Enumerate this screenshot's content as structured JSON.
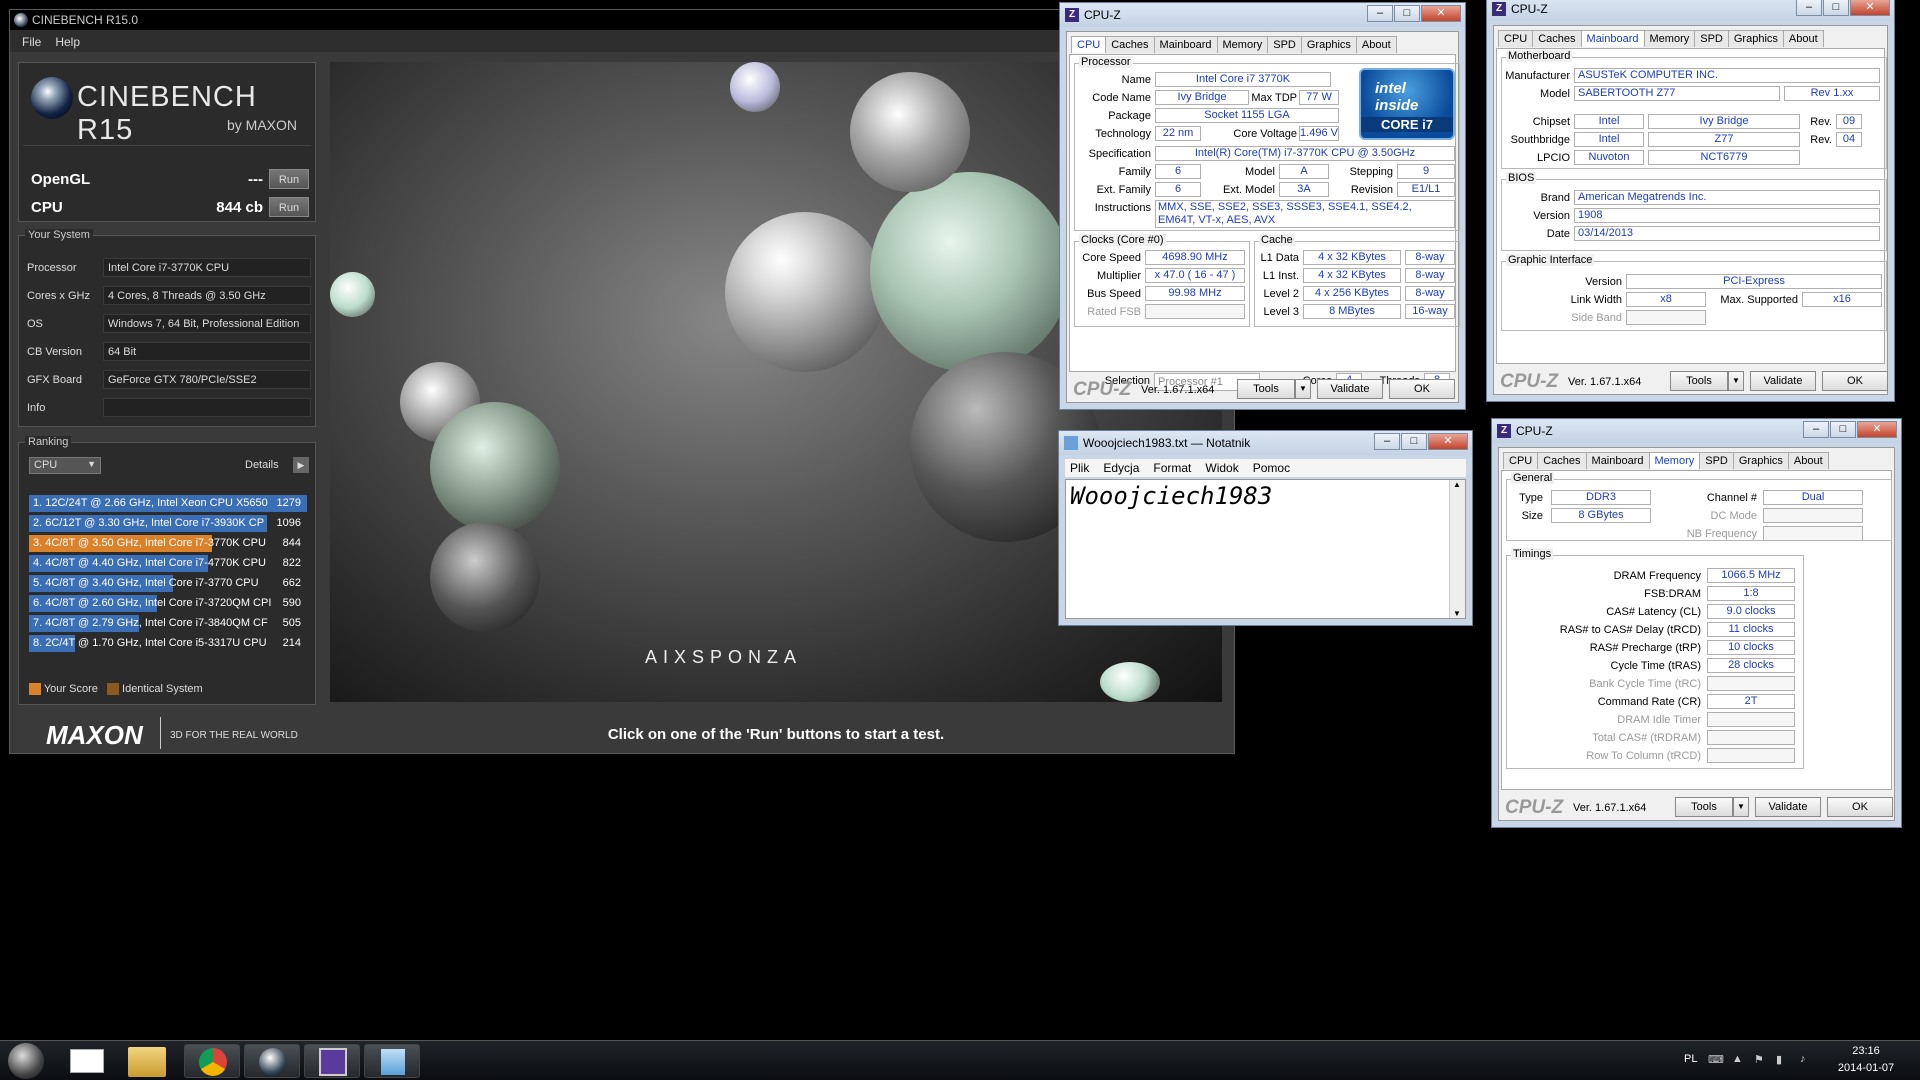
{
  "cinebench": {
    "title": "CINEBENCH R15.0",
    "menu": [
      "File",
      "Help"
    ],
    "logo_name": "CINEBENCH R15",
    "logo_by": "by MAXON",
    "opengl_label": "OpenGL",
    "opengl_value": "---",
    "cpu_label": "CPU",
    "cpu_value": "844 cb",
    "run_label": "Run",
    "your_system": "Your System",
    "system": [
      {
        "label": "Processor",
        "value": "Intel Core i7-3770K CPU"
      },
      {
        "label": "Cores x GHz",
        "value": "4 Cores, 8 Threads @ 3.50 GHz"
      },
      {
        "label": "OS",
        "value": "Windows 7, 64 Bit, Professional Edition"
      },
      {
        "label": "CB Version",
        "value": "64 Bit"
      },
      {
        "label": "GFX Board",
        "value": "GeForce GTX 780/PCIe/SSE2"
      },
      {
        "label": "Info",
        "value": ""
      }
    ],
    "ranking_title": "Ranking",
    "ranking_select": "CPU",
    "details_label": "Details",
    "ranking": [
      {
        "text": "1. 12C/24T @ 2.66 GHz, Intel Xeon CPU X5650",
        "score": "1279",
        "fill": 1.0,
        "color": "#3a6fb5"
      },
      {
        "text": "2. 6C/12T @ 3.30 GHz,  Intel Core i7-3930K CP",
        "score": "1096",
        "fill": 0.857,
        "color": "#3a6fb5"
      },
      {
        "text": "3. 4C/8T @ 3.50 GHz,  Intel Core i7-3770K CPU",
        "score": "844",
        "fill": 0.66,
        "color": "#d9822b"
      },
      {
        "text": "4. 4C/8T @ 4.40 GHz, Intel Core i7-4770K CPU",
        "score": "822",
        "fill": 0.643,
        "color": "#3a6fb5"
      },
      {
        "text": "5. 4C/8T @ 3.40 GHz,  Intel Core i7-3770 CPU",
        "score": "662",
        "fill": 0.518,
        "color": "#3a6fb5"
      },
      {
        "text": "6. 4C/8T @ 2.60 GHz, Intel Core i7-3720QM CPI",
        "score": "590",
        "fill": 0.461,
        "color": "#3a6fb5"
      },
      {
        "text": "7. 4C/8T @ 2.79 GHz,  Intel Core i7-3840QM CF",
        "score": "505",
        "fill": 0.395,
        "color": "#3a6fb5"
      },
      {
        "text": "8. 2C/4T @ 1.70 GHz,  Intel Core i5-3317U CPU",
        "score": "214",
        "fill": 0.167,
        "color": "#3a6fb5"
      }
    ],
    "legend_your": "Your Score",
    "legend_identical": "Identical System",
    "maxon": "MAXON",
    "tagline": "3D FOR THE REAL WORLD",
    "aixsponza": "AIXSPONZA",
    "status": "Click on one of the 'Run' buttons to start a test."
  },
  "cpuz1": {
    "title": "CPU-Z",
    "tabs": [
      "CPU",
      "Caches",
      "Mainboard",
      "Memory",
      "SPD",
      "Graphics",
      "About"
    ],
    "processor": "Processor",
    "name_l": "Name",
    "name": "Intel Core i7 3770K",
    "code_l": "Code Name",
    "code": "Ivy Bridge",
    "tdp_l": "Max TDP",
    "tdp": "77 W",
    "pkg_l": "Package",
    "pkg": "Socket 1155 LGA",
    "tech_l": "Technology",
    "tech": "22 nm",
    "cv_l": "Core Voltage",
    "cv": "1.496 V",
    "spec_l": "Specification",
    "spec": "Intel(R) Core(TM) i7-3770K CPU @ 3.50GHz",
    "fam_l": "Family",
    "fam": "6",
    "model_l": "Model",
    "model": "A",
    "step_l": "Stepping",
    "step": "9",
    "efam_l": "Ext. Family",
    "efam": "6",
    "emod_l": "Ext. Model",
    "emod": "3A",
    "rev_l": "Revision",
    "rev": "E1/L1",
    "inst_l": "Instructions",
    "inst": "MMX, SSE, SSE2, SSE3, SSSE3, SSE4.1, SSE4.2, EM64T, VT-x, AES, AVX",
    "clocks": "Clocks (Core #0)",
    "cs_l": "Core Speed",
    "cs": "4698.90 MHz",
    "mul_l": "Multiplier",
    "mul": "x 47.0 ( 16 - 47 )",
    "bus_l": "Bus Speed",
    "bus": "99.98 MHz",
    "fsb_l": "Rated FSB",
    "cache": "Cache",
    "l1d_l": "L1 Data",
    "l1d": "4 x 32 KBytes",
    "l1d_w": "8-way",
    "l1i_l": "L1 Inst.",
    "l1i": "4 x 32 KBytes",
    "l1i_w": "8-way",
    "l2_l": "Level 2",
    "l2": "4 x 256 KBytes",
    "l2_w": "8-way",
    "l3_l": "Level 3",
    "l3": "8 MBytes",
    "l3_w": "16-way",
    "sel_l": "Selection",
    "sel": "Processor #1",
    "cores_l": "Cores",
    "cores": "4",
    "thr_l": "Threads",
    "thr": "8",
    "logo": "CPU-Z",
    "ver": "Ver. 1.67.1.x64",
    "tools": "Tools",
    "validate": "Validate",
    "ok": "OK",
    "intel_inside": "intel inside",
    "intel_core": "CORE i7"
  },
  "cpuz2": {
    "title": "CPU-Z",
    "tabs": [
      "CPU",
      "Caches",
      "Mainboard",
      "Memory",
      "SPD",
      "Graphics",
      "About"
    ],
    "mb": "Motherboard",
    "man_l": "Manufacturer",
    "man": "ASUSTeK COMPUTER INC.",
    "model_l": "Model",
    "model": "SABERTOOTH Z77",
    "modrev": "Rev 1.xx",
    "chip_l": "Chipset",
    "chip": "Intel",
    "chip2": "Ivy Bridge",
    "rev_l": "Rev.",
    "rev": "09",
    "sb_l": "Southbridge",
    "sb": "Intel",
    "sb2": "Z77",
    "sbrev": "04",
    "lpc_l": "LPCIO",
    "lpc": "Nuvoton",
    "lpc2": "NCT6779",
    "bios": "BIOS",
    "brand_l": "Brand",
    "brand": "American Megatrends Inc.",
    "ver_l": "Version",
    "ver": "1908",
    "date_l": "Date",
    "date": "03/14/2013",
    "gi": "Graphic Interface",
    "giv_l": "Version",
    "giv": "PCI-Express",
    "lw_l": "Link Width",
    "lw": "x8",
    "ms_l": "Max. Supported",
    "ms": "x16",
    "sbd_l": "Side Band",
    "logo": "CPU-Z",
    "verstr": "Ver. 1.67.1.x64",
    "tools": "Tools",
    "validate": "Validate",
    "ok": "OK"
  },
  "cpuz3": {
    "title": "CPU-Z",
    "tabs": [
      "CPU",
      "Caches",
      "Mainboard",
      "Memory",
      "SPD",
      "Graphics",
      "About"
    ],
    "general": "General",
    "type_l": "Type",
    "type": "DDR3",
    "ch_l": "Channel #",
    "ch": "Dual",
    "size_l": "Size",
    "size": "8 GBytes",
    "dc_l": "DC Mode",
    "nb_l": "NB Frequency",
    "timings": "Timings",
    "t": [
      {
        "l": "DRAM Frequency",
        "v": "1066.5 MHz",
        "g": false
      },
      {
        "l": "FSB:DRAM",
        "v": "1:8",
        "g": false
      },
      {
        "l": "CAS# Latency (CL)",
        "v": "9.0 clocks",
        "g": false
      },
      {
        "l": "RAS# to CAS# Delay (tRCD)",
        "v": "11 clocks",
        "g": false
      },
      {
        "l": "RAS# Precharge (tRP)",
        "v": "10 clocks",
        "g": false
      },
      {
        "l": "Cycle Time (tRAS)",
        "v": "28 clocks",
        "g": false
      },
      {
        "l": "Bank Cycle Time (tRC)",
        "v": "",
        "g": true
      },
      {
        "l": "Command Rate (CR)",
        "v": "2T",
        "g": false
      },
      {
        "l": "DRAM Idle Timer",
        "v": "",
        "g": true
      },
      {
        "l": "Total CAS# (tRDRAM)",
        "v": "",
        "g": true
      },
      {
        "l": "Row To Column (tRCD)",
        "v": "",
        "g": true
      }
    ],
    "logo": "CPU-Z",
    "verstr": "Ver. 1.67.1.x64",
    "tools": "Tools",
    "validate": "Validate",
    "ok": "OK"
  },
  "notepad": {
    "title": "Wooojciech1983.txt — Notatnik",
    "menu": [
      "Plik",
      "Edycja",
      "Format",
      "Widok",
      "Pomoc"
    ],
    "content": "Wooojciech1983"
  },
  "taskbar": {
    "lang": "PL",
    "time": "23:16",
    "date": "2014-01-07",
    "items": [
      "start-orb-icon",
      "mail-icon",
      "explorer-icon",
      "chrome-icon",
      "cinebench-icon",
      "cpuz-icon",
      "notepad-icon"
    ]
  }
}
